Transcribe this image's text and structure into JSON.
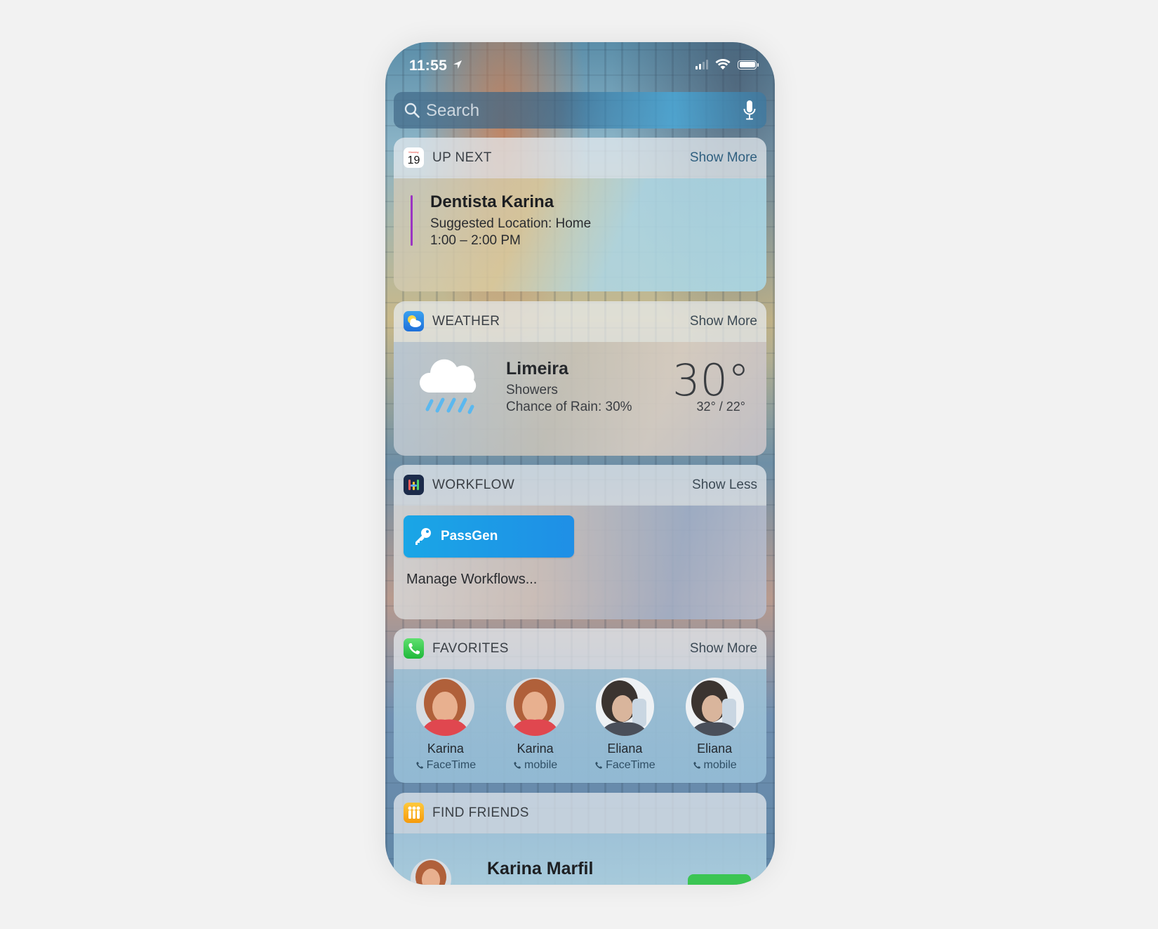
{
  "status_bar": {
    "time": "11:55",
    "icons": [
      "location-arrow-icon",
      "signal-icon",
      "wifi-icon",
      "battery-icon"
    ]
  },
  "search": {
    "placeholder": "Search",
    "icon": "search-icon",
    "mic_icon": "microphone-icon"
  },
  "widgets": {
    "up_next": {
      "calendar_weekday": "Monday",
      "calendar_day": "19",
      "title": "UP NEXT",
      "action": "Show More",
      "event": {
        "title": "Dentista Karina",
        "location": "Suggested Location: Home",
        "time": "1:00 – 2:00 PM",
        "color": "#9b35c3"
      }
    },
    "weather": {
      "title": "WEATHER",
      "action": "Show More",
      "city": "Limeira",
      "condition": "Showers",
      "rain": "Chance of Rain: 30%",
      "temperature": "30°",
      "range": "32° / 22°",
      "icon": "rain-cloud-icon"
    },
    "workflow": {
      "title": "WORKFLOW",
      "action": "Show Less",
      "button_label": "PassGen",
      "button_icon": "key-icon",
      "manage_label": "Manage Workflows..."
    },
    "favorites": {
      "title": "FAVORITES",
      "action": "Show More",
      "contacts": [
        {
          "name": "Karina",
          "type": "FaceTime"
        },
        {
          "name": "Karina",
          "type": "mobile"
        },
        {
          "name": "Eliana",
          "type": "FaceTime"
        },
        {
          "name": "Eliana",
          "type": "mobile"
        }
      ]
    },
    "find_friends": {
      "title": "FIND FRIENDS",
      "friend_name": "Karina Marfil"
    }
  },
  "colors": {
    "accent_blue": "#1f8fe6",
    "event_bar": "#9b35c3",
    "favorites_green": "#34c759",
    "find_friends_orange": "#f5a623"
  }
}
